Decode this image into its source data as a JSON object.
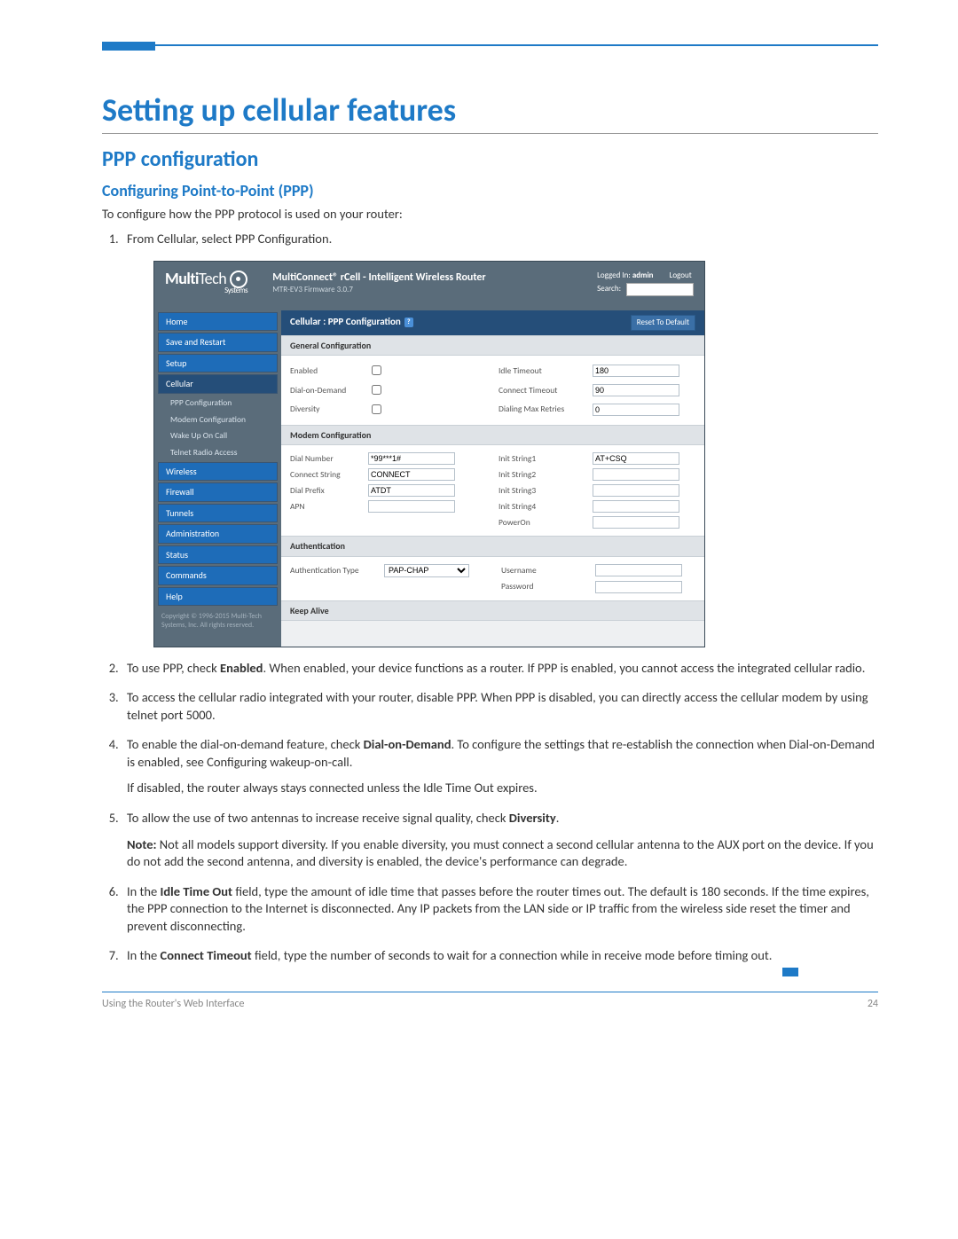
{
  "doc": {
    "h1": "Setting up cellular features",
    "h2": "PPP configuration",
    "h3": "Configuring Point-to-Point (PPP)",
    "intro": "To configure how the PPP protocol is used on your router:",
    "steps": {
      "s1": "From Cellular, select PPP Configuration.",
      "s2a": "To use PPP, check ",
      "s2b": "Enabled",
      "s2c": ". When enabled, your device functions as a router. If PPP is enabled, you cannot access the integrated cellular radio.",
      "s3": "To access the cellular radio integrated with your router, disable PPP. When PPP is disabled, you can directly access the cellular modem by using telnet port 5000.",
      "s4a": "To enable the dial-on-demand feature, check ",
      "s4b": "Dial-on-Demand",
      "s4c": ". To configure the settings that re-establish the connection when Dial-on-Demand is enabled, see Configuring wakeup-on-call.",
      "s4p": "If disabled, the router always stays connected unless the Idle Time Out expires.",
      "s5a": "To allow the use of two antennas to increase receive signal quality, check ",
      "s5b": "Diversity",
      "s5c": ".",
      "s5pa": "Note:",
      "s5pb": " Not all models support diversity. If you enable diversity, you must connect a second cellular antenna to the AUX port on the device. If you do not add the second antenna, and diversity is enabled, the device's performance can degrade.",
      "s6a": "In the ",
      "s6b": "Idle Time Out",
      "s6c": " field, type the amount of idle time that passes before the router times out. The default is 180 seconds. If the time expires, the PPP connection to the Internet is disconnected. Any IP packets from the LAN side or IP traffic from the wireless side reset the timer and prevent disconnecting.",
      "s7a": "In the ",
      "s7b": "Connect Timeout",
      "s7c": " field, type the number of seconds to wait for a connection while in receive mode before timing out."
    },
    "footer_left": "Using the Router's Web Interface",
    "footer_right": "24"
  },
  "shot": {
    "logo1": "Multi",
    "logo2": "Tech",
    "logo_sys": "Systems",
    "prod_title": "MultiConnect® rCell - Intelligent Wireless Router",
    "prod_sub": "MTR-EV3   Firmware 3.0.7",
    "logged_in": "Logged In:",
    "admin": "admin",
    "logout": "Logout",
    "search": "Search:",
    "nav": {
      "home": "Home",
      "save": "Save and Restart",
      "setup": "Setup",
      "cellular": "Cellular",
      "ppp": "PPP Configuration",
      "modem": "Modem Configuration",
      "wake": "Wake Up On Call",
      "telnet": "Telnet Radio Access",
      "wireless": "Wireless",
      "firewall": "Firewall",
      "tunnels": "Tunnels",
      "admin": "Administration",
      "status": "Status",
      "commands": "Commands",
      "help": "Help"
    },
    "copy": "Copyright © 1996-2015\nMulti-Tech Systems, Inc.\nAll rights reserved.",
    "titlebar": "Cellular : PPP Configuration",
    "help_icon": "?",
    "reset": "Reset To Default",
    "sections": {
      "general": "General Configuration",
      "modem": "Modem Configuration",
      "auth": "Authentication",
      "keep": "Keep Alive"
    },
    "fields": {
      "enabled": "Enabled",
      "dod": "Dial-on-Demand",
      "diversity": "Diversity",
      "idle": "Idle Timeout",
      "idle_v": "180",
      "conn": "Connect Timeout",
      "conn_v": "90",
      "retries": "Dialing Max Retries",
      "retries_v": "0",
      "dialnum": "Dial Number",
      "dialnum_v": "*99***1#",
      "connstr": "Connect String",
      "connstr_v": "CONNECT",
      "prefix": "Dial Prefix",
      "prefix_v": "ATDT",
      "apn": "APN",
      "init1": "Init String1",
      "init1_v": "AT+CSQ",
      "init2": "Init String2",
      "init3": "Init String3",
      "init4": "Init String4",
      "poweron": "PowerOn",
      "authtype": "Authentication Type",
      "authtype_v": "PAP-CHAP",
      "user": "Username",
      "pass": "Password"
    }
  }
}
